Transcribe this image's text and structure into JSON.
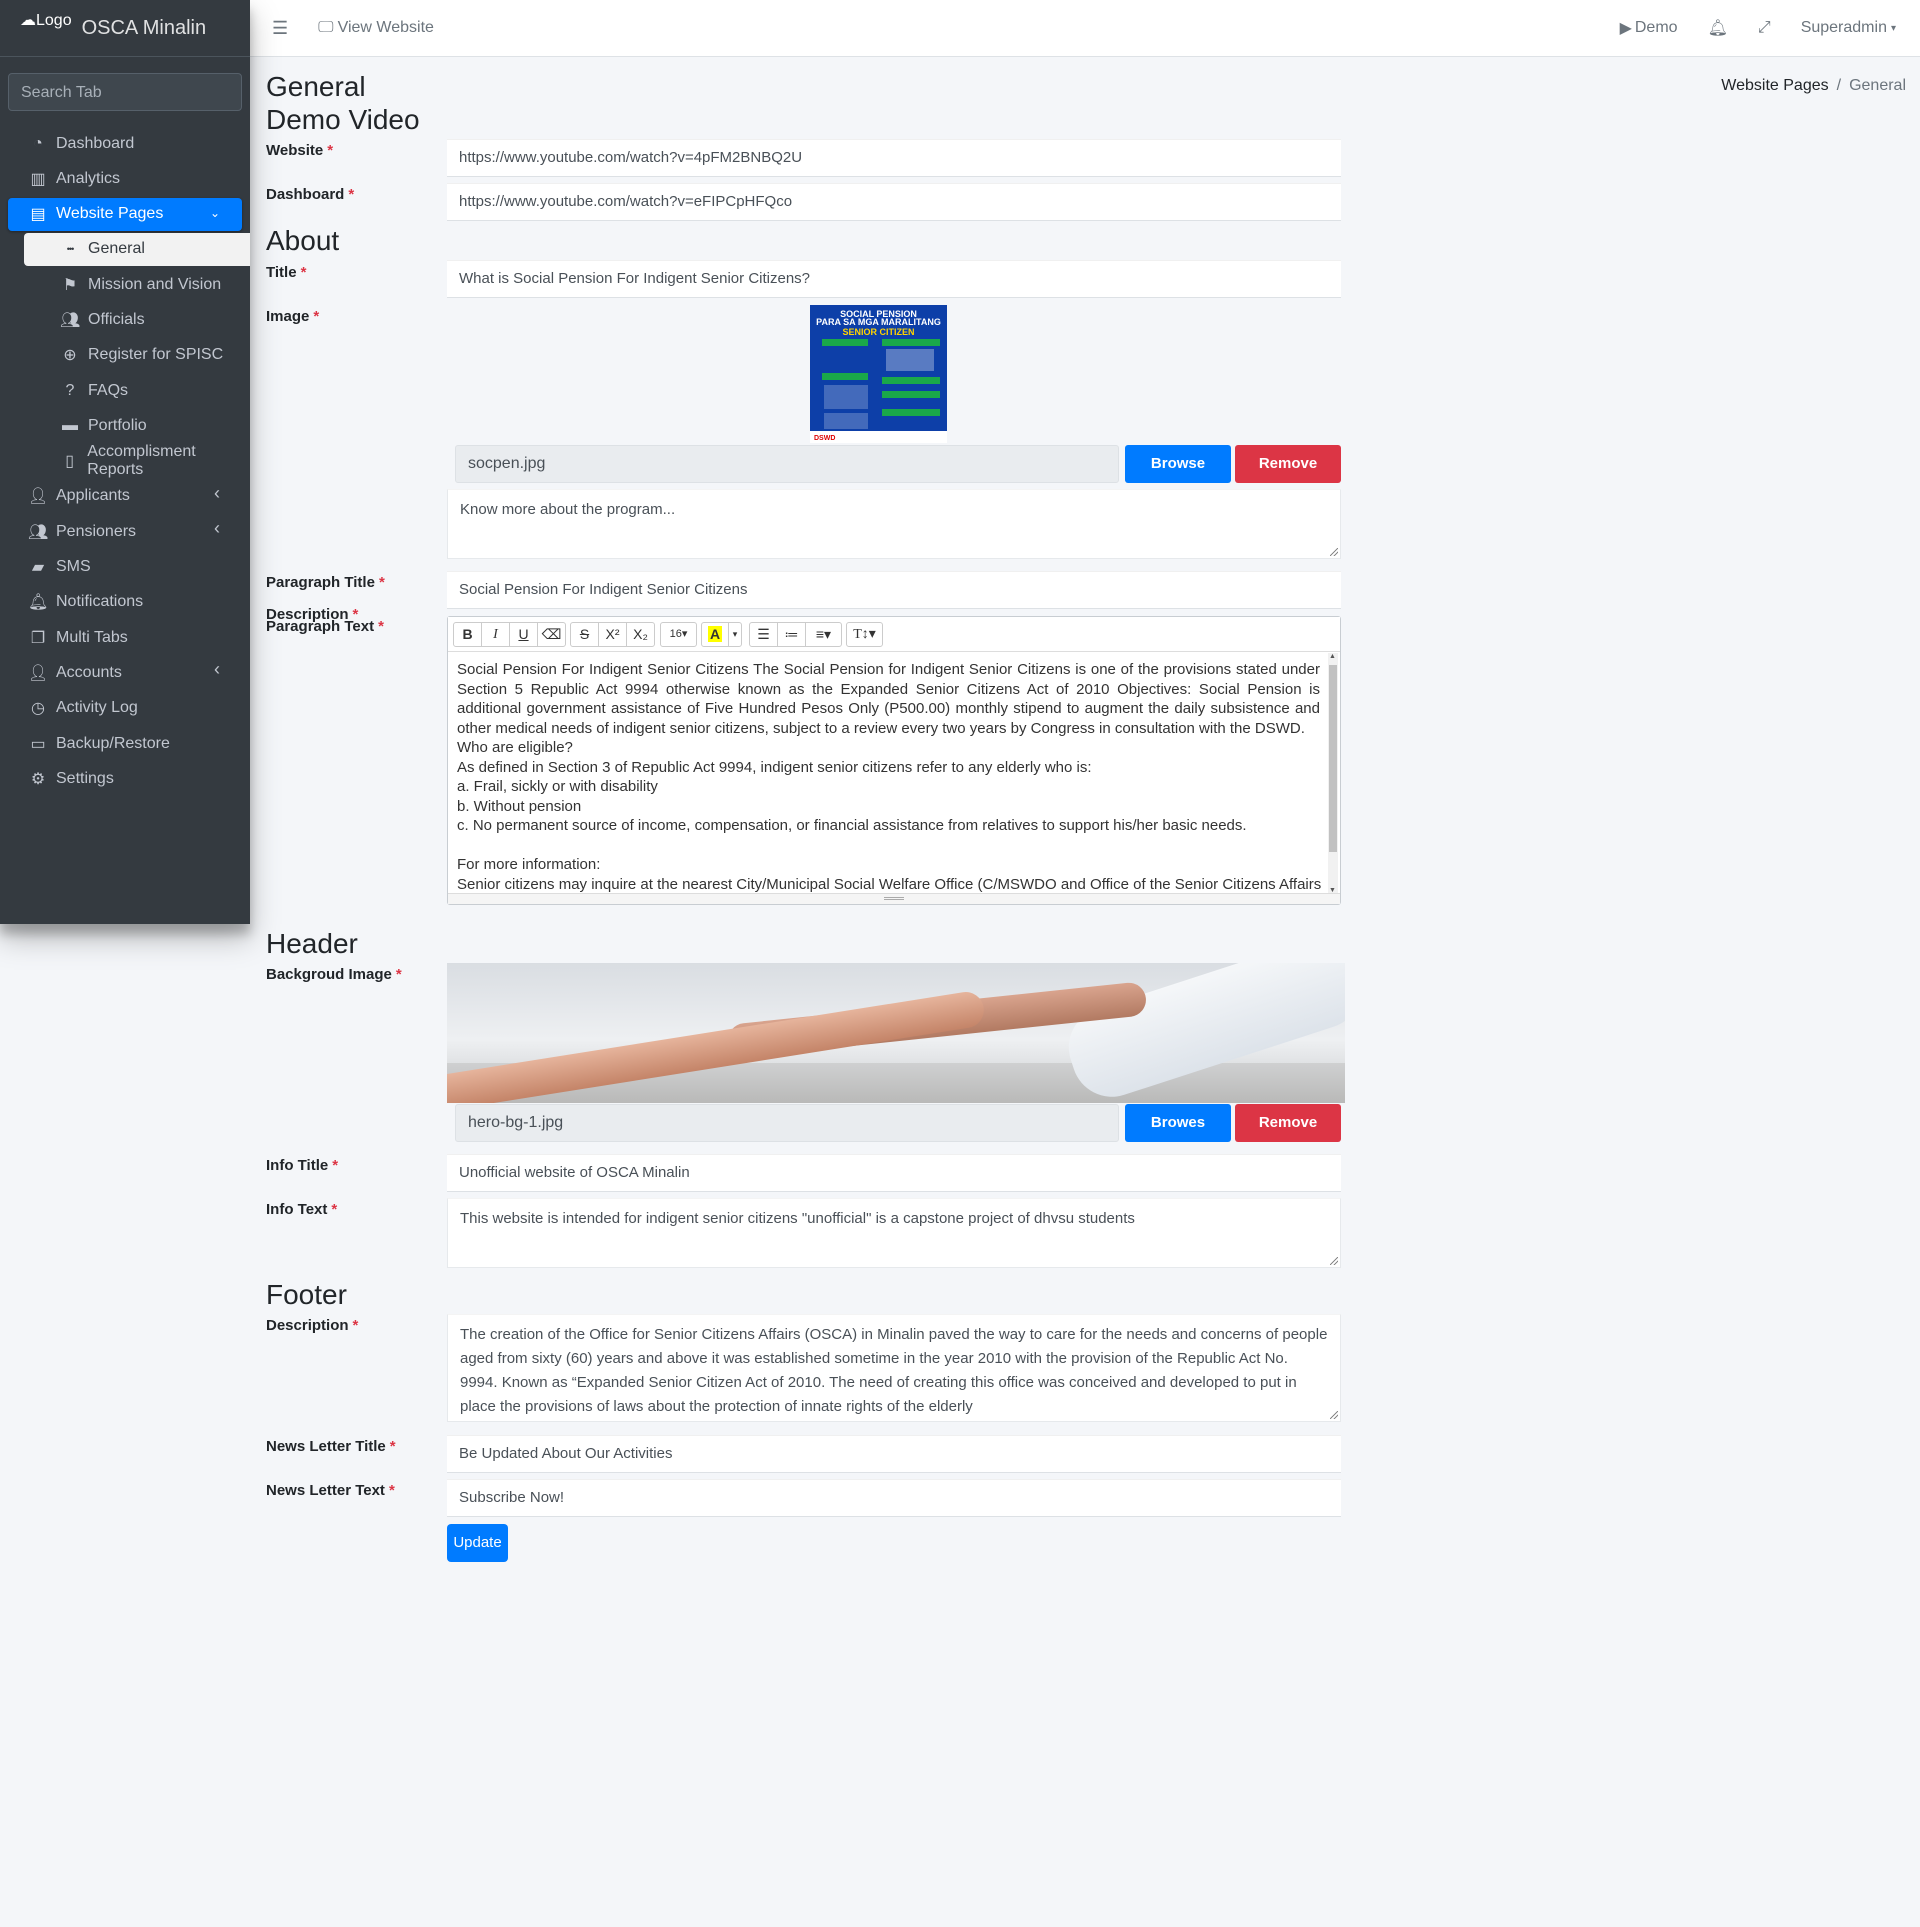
{
  "brand": {
    "logo_text": "Logo",
    "name": "OSCA Minalin"
  },
  "sidebar": {
    "search_placeholder": "Search Tab",
    "items": [
      {
        "label": "Dashboard",
        "icon": "tachometer-icon"
      },
      {
        "label": "Analytics",
        "icon": "chart-bar-icon"
      },
      {
        "label": "Website Pages",
        "icon": "book-icon",
        "active": true,
        "expanded": true
      },
      {
        "label": "General",
        "icon": "ellipsis-icon",
        "sub": true,
        "current": true
      },
      {
        "label": "Mission and Vision",
        "icon": "flag-icon",
        "sub": true
      },
      {
        "label": "Officials",
        "icon": "users-icon",
        "sub": true
      },
      {
        "label": "Register for SPISC",
        "icon": "plus-circle-icon",
        "sub": true
      },
      {
        "label": "FAQs",
        "icon": "question-circle-icon",
        "sub": true
      },
      {
        "label": "Portfolio",
        "icon": "folder-icon",
        "sub": true
      },
      {
        "label": "Accomplisment Reports",
        "icon": "file-icon",
        "sub": true
      },
      {
        "label": "Applicants",
        "icon": "user-plus-icon",
        "caret": true
      },
      {
        "label": "Pensioners",
        "icon": "users-icon",
        "caret": true
      },
      {
        "label": "SMS",
        "icon": "comment-icon"
      },
      {
        "label": "Notifications",
        "icon": "bell-icon"
      },
      {
        "label": "Multi Tabs",
        "icon": "clone-icon"
      },
      {
        "label": "Accounts",
        "icon": "user-icon",
        "caret": true
      },
      {
        "label": "Activity Log",
        "icon": "clock-icon"
      },
      {
        "label": "Backup/Restore",
        "icon": "hdd-icon"
      },
      {
        "label": "Settings",
        "icon": "cog-icon"
      }
    ]
  },
  "topbar": {
    "view_website": "View Website",
    "demo": "Demo",
    "user": "Superadmin"
  },
  "page": {
    "title": "General",
    "breadcrumb": [
      "Website Pages",
      "General"
    ]
  },
  "demo_video": {
    "heading": "Demo Video",
    "website_label": "Website",
    "website_value": "https://www.youtube.com/watch?v=4pFM2BNBQ2U",
    "dashboard_label": "Dashboard",
    "dashboard_value": "https://www.youtube.com/watch?v=eFIPCpHFQco"
  },
  "about": {
    "heading": "About",
    "title_label": "Title",
    "title_value": "What is Social Pension For Indigent Senior Citizens?",
    "image_label": "Image",
    "image_text": {
      "line1": "SOCIAL PENSION",
      "line2": "PARA SA MGA MARALITANG",
      "line3": "SENIOR CITIZEN",
      "footer": "DSWD"
    },
    "image_file": "socpen.jpg",
    "browse": "Browse",
    "remove": "Remove",
    "description_label": "Description",
    "description_value": "Know more about the program...",
    "paragraph_title_label": "Paragraph Title",
    "paragraph_title_value": "Social  Pension For Indigent Senior Citizens",
    "paragraph_text_label": "Paragraph Text",
    "editor_font_size": "16",
    "paragraph_text": [
      "Social Pension For Indigent Senior Citizens The Social Pension for Indigent Senior Citizens is one of the provisions stated under Section 5 Republic Act 9994 otherwise known as the Expanded Senior Citizens Act of 2010 Objectives: Social Pension is additional government assistance of Five Hundred Pesos Only (P500.00) monthly stipend to augment the daily subsistence and other medical needs of indigent senior citizens, subject to a review every two years by Congress in consultation with the DSWD.",
      "Who are eligible?",
      "As defined in Section 3 of Republic Act 9994, indigent senior citizens refer to any elderly who is:",
      "a. Frail, sickly or with disability",
      "b. Without pension",
      "c. No permanent source of income, compensation, or financial assistance from relatives to support his/her basic needs.",
      "",
      "For more information:",
      "Senior citizens may inquire at the nearest City/Municipal Social Welfare Office (C/MSWDO and Office of the Senior Citizens Affairs"
    ]
  },
  "header": {
    "heading": "Header",
    "bg_label": "Backgroud Image",
    "bg_file": "hero-bg-1.jpg",
    "browse": "Browes",
    "remove": "Remove",
    "info_title_label": "Info Title",
    "info_title_value": "Unofficial website of OSCA Minalin",
    "info_text_label": "Info Text",
    "info_text_value": "This website is intended for indigent senior citizens  \"unofficial\" is a capstone project of dhvsu students"
  },
  "footer": {
    "heading": "Footer",
    "description_label": "Description",
    "description_value": "The creation of the Office for Senior Citizens Affairs (OSCA) in Minalin paved the way to care for the needs and concerns of people aged from sixty (60) years and above it was established sometime in the year 2010 with the provision of the Republic Act No. 9994. Known as “Expanded Senior Citizen Act of 2010. The need of creating this office was conceived and developed to put in place the provisions of laws about the protection of innate rights of the elderly",
    "newsletter_title_label": "News Letter Title",
    "newsletter_title_value": "Be Updated About Our Activities",
    "newsletter_text_label": "News Letter Text",
    "newsletter_text_value": "Subscribe Now!",
    "update": "Update"
  },
  "colors": {
    "primary": "#007bff",
    "danger": "#dc3545",
    "sidebar_bg": "#343a40"
  }
}
